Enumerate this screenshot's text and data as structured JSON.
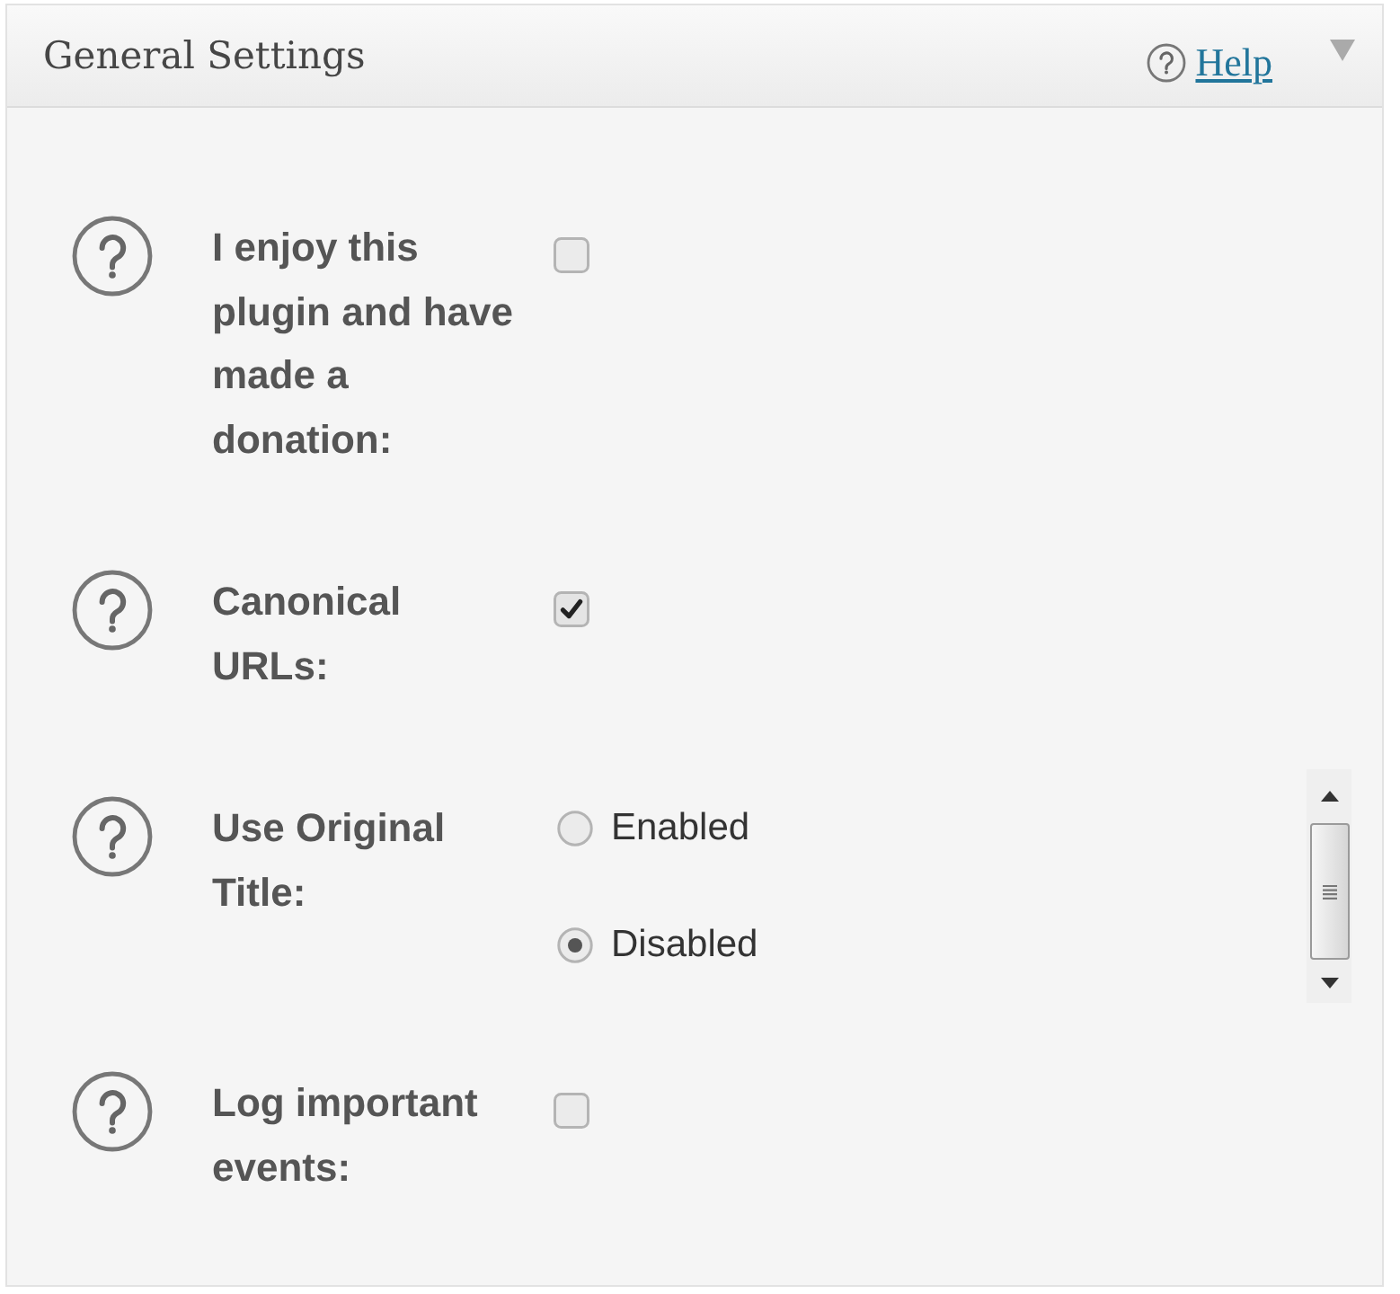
{
  "panel": {
    "title": "General Settings",
    "help_link": "Help"
  },
  "settings": [
    {
      "kind": "checkbox",
      "label": "I enjoy this plugin and have made a donation:",
      "checked": false
    },
    {
      "kind": "checkbox",
      "label": "Canonical URLs:",
      "checked": true
    },
    {
      "kind": "radio",
      "label": "Use Original Title:",
      "options": [
        {
          "label": "Enabled",
          "selected": false
        },
        {
          "label": "Disabled",
          "selected": true
        }
      ]
    },
    {
      "kind": "checkbox",
      "label": "Log important events:",
      "checked": false
    }
  ]
}
